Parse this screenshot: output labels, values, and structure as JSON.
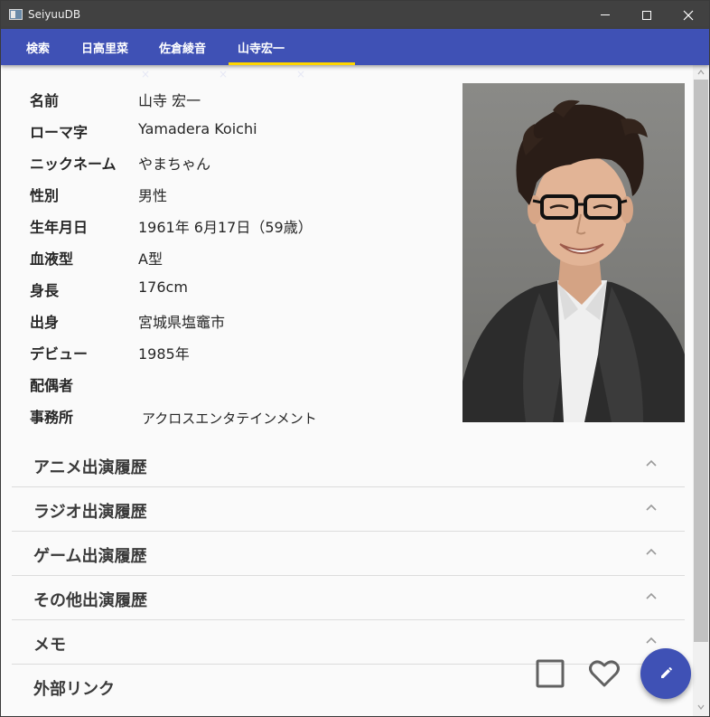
{
  "app": {
    "title": "SeiyuuDB"
  },
  "tabs": [
    {
      "label": "検索",
      "closable": false,
      "active": false
    },
    {
      "label": "日高里菜",
      "closable": true,
      "active": false
    },
    {
      "label": "佐倉綾音",
      "closable": true,
      "active": false
    },
    {
      "label": "山寺宏一",
      "closable": true,
      "active": true
    }
  ],
  "tab_close_glyph": "×",
  "profile": {
    "fields": [
      {
        "label": "名前",
        "value": "山寺 宏一"
      },
      {
        "label": "ローマ字",
        "value": "Yamadera Koichi"
      },
      {
        "label": "ニックネーム",
        "value": "やまちゃん"
      },
      {
        "label": "性別",
        "value": "男性"
      },
      {
        "label": "生年月日",
        "value": "1961年 6月17日（59歳）"
      },
      {
        "label": "血液型",
        "value": "A型"
      },
      {
        "label": "身長",
        "value": "176cm"
      },
      {
        "label": "出身",
        "value": "宮城県塩竈市"
      },
      {
        "label": "デビュー",
        "value": "1985年"
      },
      {
        "label": "配偶者",
        "value": ""
      },
      {
        "label": "事務所",
        "value": "アクロスエンタテインメント"
      }
    ]
  },
  "sections": [
    {
      "title": "アニメ出演履歴"
    },
    {
      "title": "ラジオ出演履歴"
    },
    {
      "title": "ゲーム出演履歴"
    },
    {
      "title": "その他出演履歴"
    },
    {
      "title": "メモ"
    },
    {
      "title": "外部リンク"
    }
  ],
  "colors": {
    "primary": "#3f51b5",
    "tab_indicator": "#ffd600",
    "titlebar": "#414141"
  },
  "icons": {
    "edit": "pencil-icon",
    "favorite": "heart-outline-icon",
    "select": "square-outline-icon"
  }
}
